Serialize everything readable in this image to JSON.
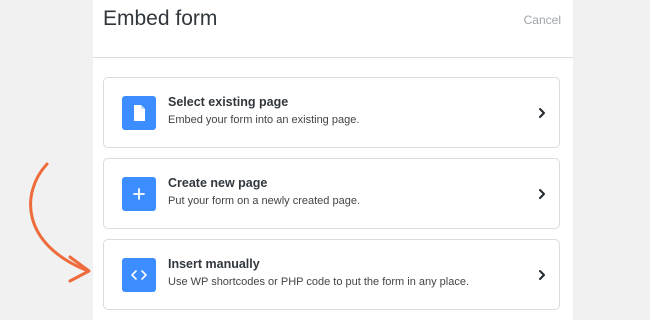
{
  "modal": {
    "title": "Embed form",
    "cancel_label": "Cancel"
  },
  "options": [
    {
      "title": "Select existing page",
      "description": "Embed your form into an existing page.",
      "icon": "document-icon"
    },
    {
      "title": "Create new page",
      "description": "Put your form on a newly created page.",
      "icon": "plus-icon"
    },
    {
      "title": "Insert manually",
      "description": "Use WP shortcodes or PHP code to put the form in any place.",
      "icon": "code-icon"
    }
  ],
  "colors": {
    "accent": "#3c8dff",
    "arrow": "#ee6b3b",
    "backdrop": "#f1f1f1",
    "border": "#dcdcde"
  }
}
